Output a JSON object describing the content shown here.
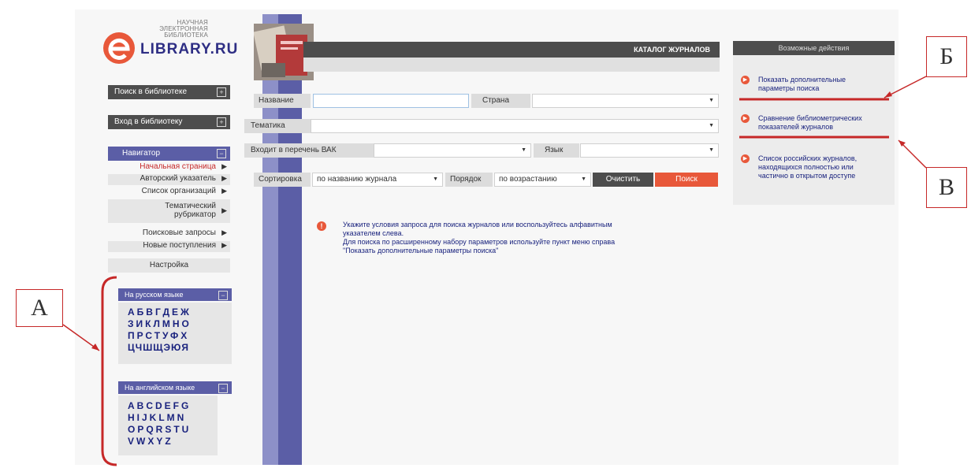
{
  "logo": {
    "small_line1": "НАУЧНАЯ ЭЛЕКТРОННАЯ",
    "small_line2": "БИБЛИОТЕКА",
    "big": "LIBRARY.RU"
  },
  "left_nav": {
    "search_library": "Поиск в библиотеке",
    "login_library": "Вход в библиотеку",
    "navigator_header": "Навигатор",
    "items": [
      {
        "label": "Начальная страница"
      },
      {
        "label": "Авторский указатель"
      },
      {
        "label": "Список организаций"
      },
      {
        "label": "Тематический рубрикатор"
      },
      {
        "label": "Поисковые запросы"
      },
      {
        "label": "Новые поступления"
      }
    ],
    "settings": "Настройка"
  },
  "alphabet": {
    "russian_header": "На русском языке",
    "russian_rows": [
      "АБВГДЕЖ",
      "ЗИКЛМНО",
      "ПРСТУФХ",
      "ЦЧШЩЭЮЯ"
    ],
    "english_header": "На английском языке",
    "english_rows": [
      "ABCDEFG",
      "HIJKLMN",
      "OPQRSTU",
      "VWXYZ"
    ]
  },
  "catalog": {
    "title": "КАТАЛОГ ЖУРНАЛОВ"
  },
  "form": {
    "name_label": "Название",
    "name_value": "",
    "country_label": "Страна",
    "country_value": "",
    "topic_label": "Тематика",
    "topic_value": "",
    "vak_label": "Входит в перечень ВАК",
    "vak_value": "",
    "language_label": "Язык",
    "language_value": "",
    "sort_label": "Сортировка",
    "sort_value": "по названию журнала",
    "order_label": "Порядок",
    "order_value": "по возрастанию",
    "clear_button": "Очистить",
    "search_button": "Поиск"
  },
  "info": {
    "line1": "Укажите условия запроса для поиска журналов или воспользуйтесь алфавитным",
    "line2": "указателем слева.",
    "line3": "Для поиска по расширенному набору параметров используйте пункт меню справа",
    "line4": "\"Показать дополнительные параметры поиска\""
  },
  "right_panel": {
    "header": "Возможные действия",
    "actions": [
      {
        "line1": "Показать дополнительные",
        "line2": "параметры поиска"
      },
      {
        "line1": "Сравнение библиометрических",
        "line2": "показателей журналов"
      },
      {
        "line1": "Список российских журналов,",
        "line2": "находящихся полностью или",
        "line3": "частично в открытом доступе"
      }
    ]
  },
  "annotations": {
    "a": "А",
    "b": "Б",
    "v": "В"
  },
  "colors": {
    "accent_orange": "#e8583a",
    "nav_blue": "#5b5ea6",
    "annotation_red": "#c62828",
    "dark_bar": "#4d4d4d"
  }
}
